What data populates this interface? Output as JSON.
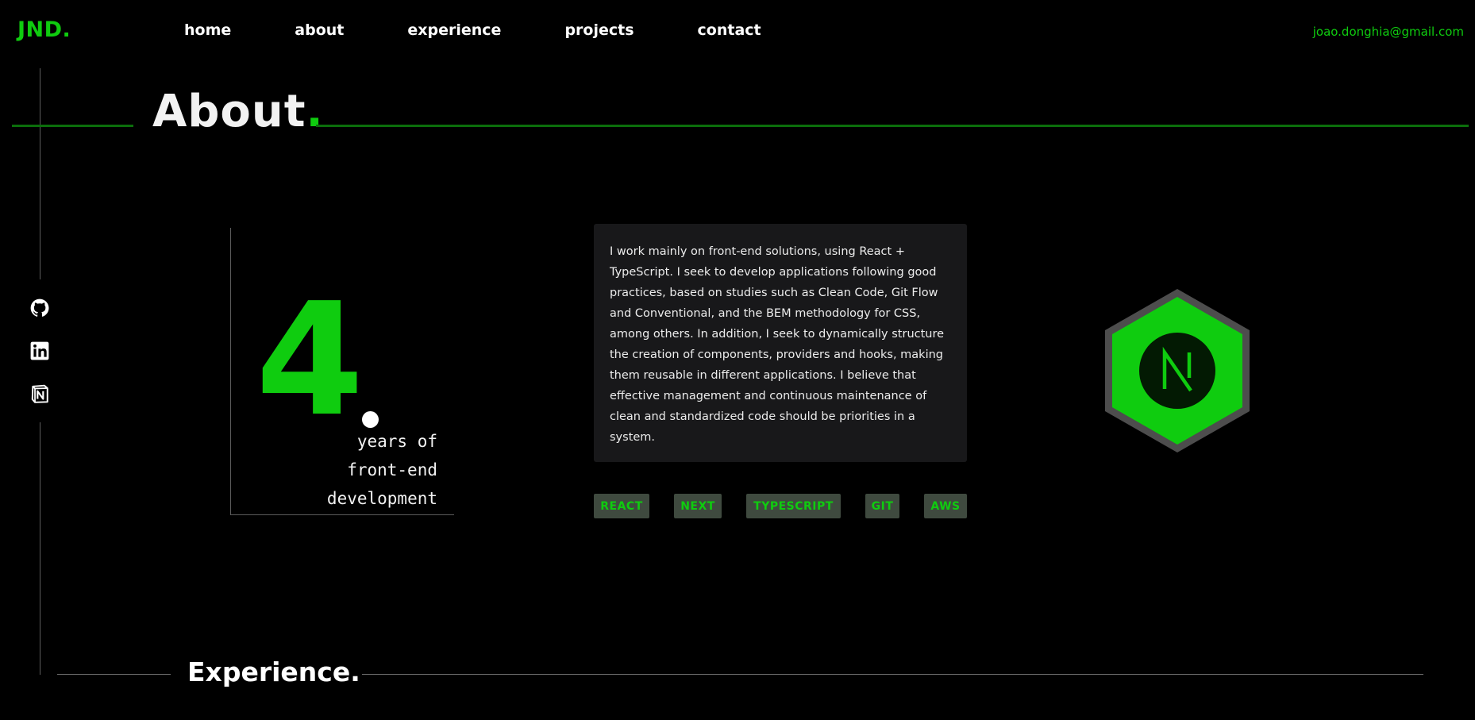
{
  "header": {
    "logo": "JND.",
    "nav": [
      "home",
      "about",
      "experience",
      "projects",
      "contact"
    ],
    "email": "joao.donghia@gmail.com"
  },
  "social": [
    "github-icon",
    "linkedin-icon",
    "notion-icon"
  ],
  "about": {
    "title": "About",
    "title_dot": ".",
    "years_number": "4",
    "years_caption": [
      "years of",
      "front-end",
      "development"
    ],
    "description": "I work mainly on front-end solutions, using React + TypeScript. I seek to develop applications following good practices, based on studies such as Clean Code, Git Flow and Conventional, and the BEM methodology for CSS, among others. In addition, I seek to dynamically structure the creation of components, providers and hooks, making them reusable in different applications. I believe that effective management and continuous maintenance of clean and standardized code should be priorities in a system.",
    "tags": [
      "REACT",
      "NEXT",
      "TYPESCRIPT",
      "GIT",
      "AWS"
    ],
    "badge_icon": "nextjs-icon"
  },
  "experience": {
    "title": "Experience."
  },
  "colors": {
    "accent": "#0fcc0f",
    "background": "#000000",
    "card": "#18181a",
    "tag_bg": "#3f4a3f"
  }
}
